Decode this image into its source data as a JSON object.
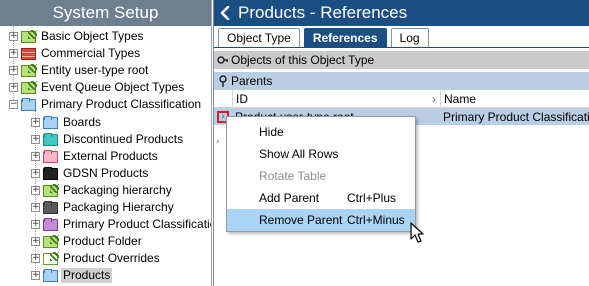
{
  "left": {
    "title": "System Setup",
    "tree": [
      {
        "label": "Basic Object Types",
        "icon": "green-hatched-icon",
        "level": 0,
        "expander": "+"
      },
      {
        "label": "Commercial Types",
        "icon": "red-stack-icon",
        "level": 0,
        "expander": "+"
      },
      {
        "label": "Entity user-type root",
        "icon": "green-hatched-icon",
        "level": 0,
        "expander": "+"
      },
      {
        "label": "Event Queue Object Types",
        "icon": "green-hatched-icon",
        "level": 0,
        "expander": "+"
      },
      {
        "label": "Primary Product Classification",
        "icon": "blue-folder-icon",
        "level": 0,
        "expander": "-"
      },
      {
        "label": "Boards",
        "icon": "blue-folder-icon",
        "level": 1,
        "expander": "+"
      },
      {
        "label": "Discontinued Products",
        "icon": "teal-folder-icon",
        "level": 1,
        "expander": "+"
      },
      {
        "label": "External Products",
        "icon": "pink-folder-icon",
        "level": 1,
        "expander": "+"
      },
      {
        "label": "GDSN Products",
        "icon": "black-folder-icon",
        "level": 1,
        "expander": "+"
      },
      {
        "label": "Packaging hierarchy",
        "icon": "green-hatched-icon",
        "level": 1,
        "expander": "+"
      },
      {
        "label": "Packaging Hierarchy",
        "icon": "dark-gray-folder-icon",
        "level": 1,
        "expander": "+"
      },
      {
        "label": "Primary Product Classification",
        "icon": "purple-folder-icon",
        "level": 1,
        "expander": "+"
      },
      {
        "label": "Product Folder",
        "icon": "green-hatched-icon",
        "level": 1,
        "expander": "+"
      },
      {
        "label": "Product Overrides",
        "icon": "hatched-folder-icon",
        "level": 1,
        "expander": "+"
      },
      {
        "label": "Products",
        "icon": "blue-folder-icon",
        "level": 1,
        "expander": "+",
        "selected": true
      }
    ]
  },
  "right": {
    "title": "Products - References",
    "tabs": [
      {
        "label": "Object Type",
        "active": false
      },
      {
        "label": "References",
        "active": true
      },
      {
        "label": "Log",
        "active": false
      }
    ],
    "section_objects": "Objects of this  Object Type",
    "section_parents": "Parents",
    "columns": [
      "ID",
      "Name"
    ],
    "rows": [
      {
        "id": "Product user-type root",
        "name": "Primary Product Classification"
      }
    ]
  },
  "context_menu": {
    "items": [
      {
        "label": "Hide",
        "shortcut": "",
        "disabled": false,
        "hover": false
      },
      {
        "label": "Show All Rows",
        "shortcut": "",
        "disabled": false,
        "hover": false
      },
      {
        "label": "Rotate Table",
        "shortcut": "",
        "disabled": true,
        "hover": false
      },
      {
        "label": "Add Parent",
        "shortcut": "Ctrl+Plus",
        "disabled": false,
        "hover": false
      },
      {
        "label": "Remove Parent",
        "shortcut": "Ctrl+Minus",
        "disabled": false,
        "hover": true
      }
    ]
  },
  "colors": {
    "header_dark_blue": "#1b4f84",
    "left_header_gray": "#6f7f92",
    "row_highlight": "#b9cde4",
    "menu_hover": "#a9d4f4",
    "marker_red": "#d1202a"
  }
}
